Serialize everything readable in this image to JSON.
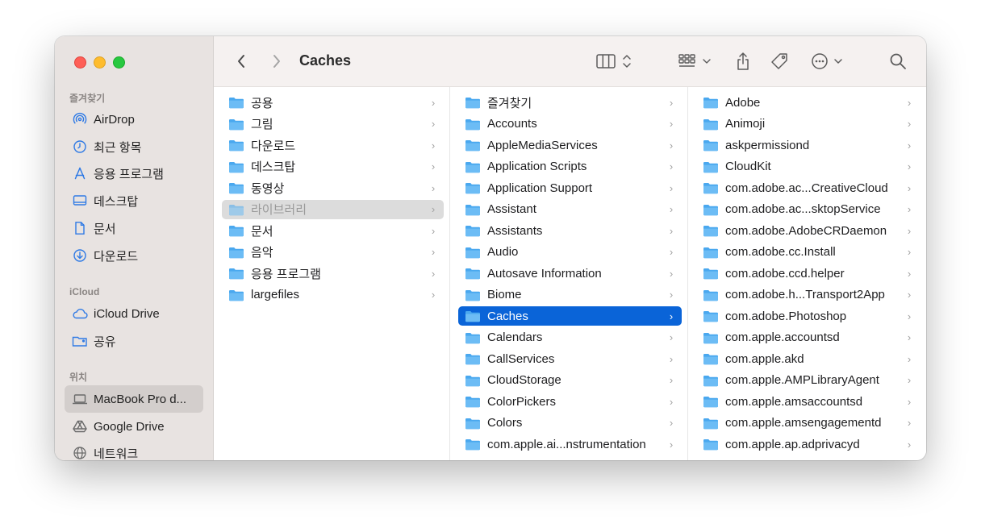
{
  "window": {
    "title": "Caches"
  },
  "sidebar": {
    "sections": [
      {
        "title": "즐겨찾기",
        "items": [
          {
            "label": "AirDrop",
            "icon": "airdrop-icon"
          },
          {
            "label": "최근 항목",
            "icon": "clock-icon"
          },
          {
            "label": "응용 프로그램",
            "icon": "applications-icon"
          },
          {
            "label": "데스크탑",
            "icon": "desktop-icon"
          },
          {
            "label": "문서",
            "icon": "document-icon"
          },
          {
            "label": "다운로드",
            "icon": "download-icon"
          }
        ]
      },
      {
        "title": "iCloud",
        "items": [
          {
            "label": "iCloud Drive",
            "icon": "cloud-icon"
          },
          {
            "label": "공유",
            "icon": "shared-folder-icon"
          }
        ]
      },
      {
        "title": "위치",
        "items": [
          {
            "label": "MacBook Pro d...",
            "icon": "laptop-icon",
            "selected": true
          },
          {
            "label": "Google Drive",
            "icon": "drive-icon"
          },
          {
            "label": "네트워크",
            "icon": "globe-icon"
          }
        ]
      }
    ]
  },
  "columns": [
    {
      "items": [
        "공용",
        "그림",
        "다운로드",
        "데스크탑",
        "동영상",
        "라이브러리",
        "문서",
        "음악",
        "응용 프로그램",
        "largefiles"
      ],
      "selected": 5
    },
    {
      "items": [
        "즐겨찾기",
        "Accounts",
        "AppleMediaServices",
        "Application Scripts",
        "Application Support",
        "Assistant",
        "Assistants",
        "Audio",
        "Autosave Information",
        "Biome",
        "Caches",
        "Calendars",
        "CallServices",
        "CloudStorage",
        "ColorPickers",
        "Colors",
        "com.apple.ai...nstrumentation"
      ],
      "selected": 10
    },
    {
      "items": [
        "Adobe",
        "Animoji",
        "askpermissiond",
        "CloudKit",
        "com.adobe.ac...CreativeCloud",
        "com.adobe.ac...sktopService",
        "com.adobe.AdobeCRDaemon",
        "com.adobe.cc.Install",
        "com.adobe.ccd.helper",
        "com.adobe.h...Transport2App",
        "com.adobe.Photoshop",
        "com.apple.accountsd",
        "com.apple.akd",
        "com.apple.AMPLibraryAgent",
        "com.apple.amsaccountsd",
        "com.apple.amsengagementd",
        "com.apple.ap.adprivacyd"
      ],
      "selected": -1
    }
  ],
  "colors": {
    "accent": "#0a64d8",
    "folder": "#4aa8ef",
    "sidebar_bg": "#e8e3e1",
    "sidebar_icon": "#2f7ae5"
  }
}
